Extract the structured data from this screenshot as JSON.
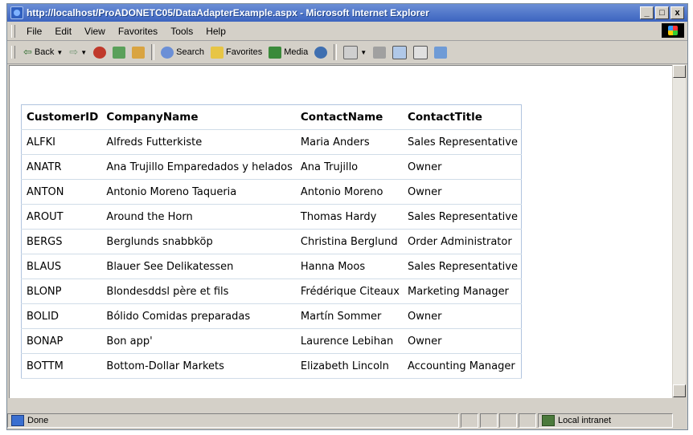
{
  "window": {
    "title": "http://localhost/ProADONETC05/DataAdapterExample.aspx - Microsoft Internet Explorer",
    "controls": {
      "minimize": "_",
      "maximize": "□",
      "close": "x"
    }
  },
  "menu": [
    "File",
    "Edit",
    "View",
    "Favorites",
    "Tools",
    "Help"
  ],
  "toolbar": {
    "back": "Back",
    "search": "Search",
    "favorites": "Favorites",
    "media": "Media"
  },
  "grid": {
    "columns": [
      "CustomerID",
      "CompanyName",
      "ContactName",
      "ContactTitle"
    ],
    "rows": [
      [
        "ALFKI",
        "Alfreds Futterkiste",
        "Maria Anders",
        "Sales Representative"
      ],
      [
        "ANATR",
        "Ana Trujillo Emparedados y helados",
        "Ana Trujillo",
        "Owner"
      ],
      [
        "ANTON",
        "Antonio Moreno Taqueria",
        "Antonio Moreno",
        "Owner"
      ],
      [
        "AROUT",
        "Around the Horn",
        "Thomas Hardy",
        "Sales Representative"
      ],
      [
        "BERGS",
        "Berglunds snabbköp",
        "Christina Berglund",
        "Order Administrator"
      ],
      [
        "BLAUS",
        "Blauer See Delikatessen",
        "Hanna Moos",
        "Sales Representative"
      ],
      [
        "BLONP",
        "Blondesddsl père et fils",
        "Frédérique Citeaux",
        "Marketing Manager"
      ],
      [
        "BOLID",
        "Bólido Comidas preparadas",
        "Martín Sommer",
        "Owner"
      ],
      [
        "BONAP",
        "Bon app'",
        "Laurence Lebihan",
        "Owner"
      ],
      [
        "BOTTM",
        "Bottom-Dollar Markets",
        "Elizabeth Lincoln",
        "Accounting Manager"
      ]
    ]
  },
  "status": {
    "text": "Done",
    "zone": "Local intranet"
  },
  "icons": {
    "back": "back-arrow-icon",
    "forward": "forward-arrow-icon",
    "stop": "stop-icon",
    "refresh": "refresh-icon",
    "home": "home-icon",
    "search": "search-icon",
    "favorites": "favorites-icon",
    "media": "media-icon",
    "history": "history-icon",
    "mail": "mail-icon",
    "print": "print-icon",
    "edit": "edit-icon",
    "discuss": "discuss-icon",
    "messenger": "messenger-icon"
  }
}
